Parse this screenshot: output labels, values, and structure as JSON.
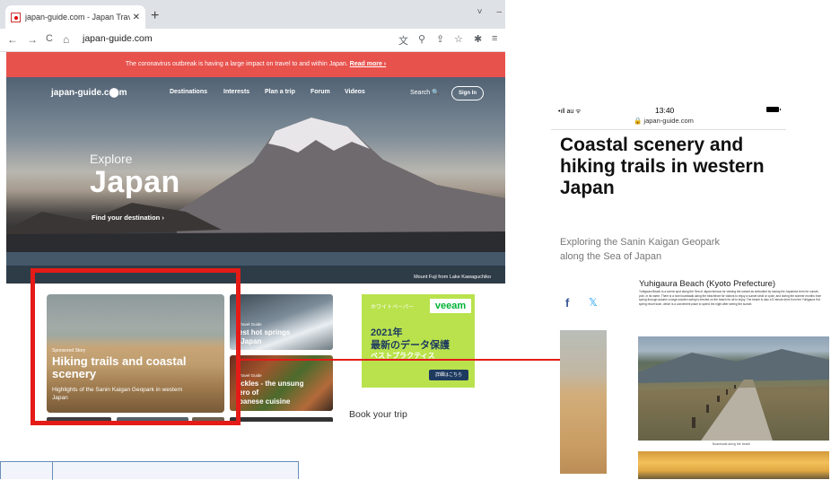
{
  "browser": {
    "tab_title": "japan-guide.com - Japan Travel and",
    "tab_close": "✕",
    "new_tab": "+",
    "window_controls": [
      "˅",
      "–"
    ],
    "nav": {
      "back": "←",
      "forward": "→",
      "reload": "C",
      "home": "⌂",
      "lock": "🔒"
    },
    "url": "japan-guide.com",
    "toolbar_icons": [
      "translate-icon",
      "zoom-icon",
      "share-icon",
      "star-icon",
      "extensions-icon",
      "reading-list-icon"
    ]
  },
  "site": {
    "notice_text": "The coronavirus outbreak is having a large impact on travel to and within Japan.",
    "notice_link": "Read more ›",
    "logo": "japan-guide.c⬤m",
    "nav": [
      "Destinations",
      "Interests",
      "Plan a trip",
      "Forum",
      "Videos"
    ],
    "search_label": "Search 🔍",
    "signin_label": "Sign In",
    "hero_explore": "Explore",
    "hero_title": "Japan",
    "hero_cta": "Find your destination ›",
    "hero_caption": "Mount Fuji from Lake Kawaguchiko"
  },
  "cards": {
    "main": {
      "tag": "Sponsored Story",
      "title": "Hiking trails and coastal scenery",
      "subtitle": "Highlights of the Sanin Kaigan Geopark in western Japan"
    },
    "small": [
      {
        "tag": "Travel Guide",
        "label": "est hot springs\n Japan"
      },
      {
        "tag": "Travel Guide",
        "label": "ickles - the unsung\nero of\npanese cuisine"
      }
    ]
  },
  "ad": {
    "top_label": "ホワイトペーパー",
    "brand": "veeam",
    "line1": "2021年",
    "line2": "最新のデータ保護",
    "line3": "ベストプラクティス",
    "button": "詳細はこちら"
  },
  "book_trip": "Book your trip",
  "phone": {
    "status_left": "•ıll au ᯤ",
    "time": "13:40",
    "url": "🔒 japan-guide.com",
    "title": "Coastal scenery and hiking trails in western Japan",
    "subtitle": "Exploring the Sanin Kaigan Geopark along the Sea of Japan",
    "fb": "f",
    "tw": "🐦"
  },
  "article": {
    "heading": "Yuhigaura Beach (Kyoto Prefecture)",
    "body": "Yuhigaura Beach is a scenic spot along the Sea of Japan famous for viewing the sunset as embodied by having the Japanese term for sunset, yuhi, in its name. There is a nice boardwalk along the beachfront for visitors to enjoy a sunset stroll or cycle, and during the warmer months from spring through autumn a large wooden swing is erected on the beach for all to enjoy. The beach is also a 5 minute drive from the Yuhigaura Hot spring resort town, which is a convenient place to spend the night after seeing the sunset.",
    "caption": "Boardwalk along the beach"
  },
  "colors": {
    "notice_bg": "#e8524d",
    "highlight": "#e41b17",
    "ad_green": "#b9e24d",
    "veeam_green": "#00b336"
  }
}
